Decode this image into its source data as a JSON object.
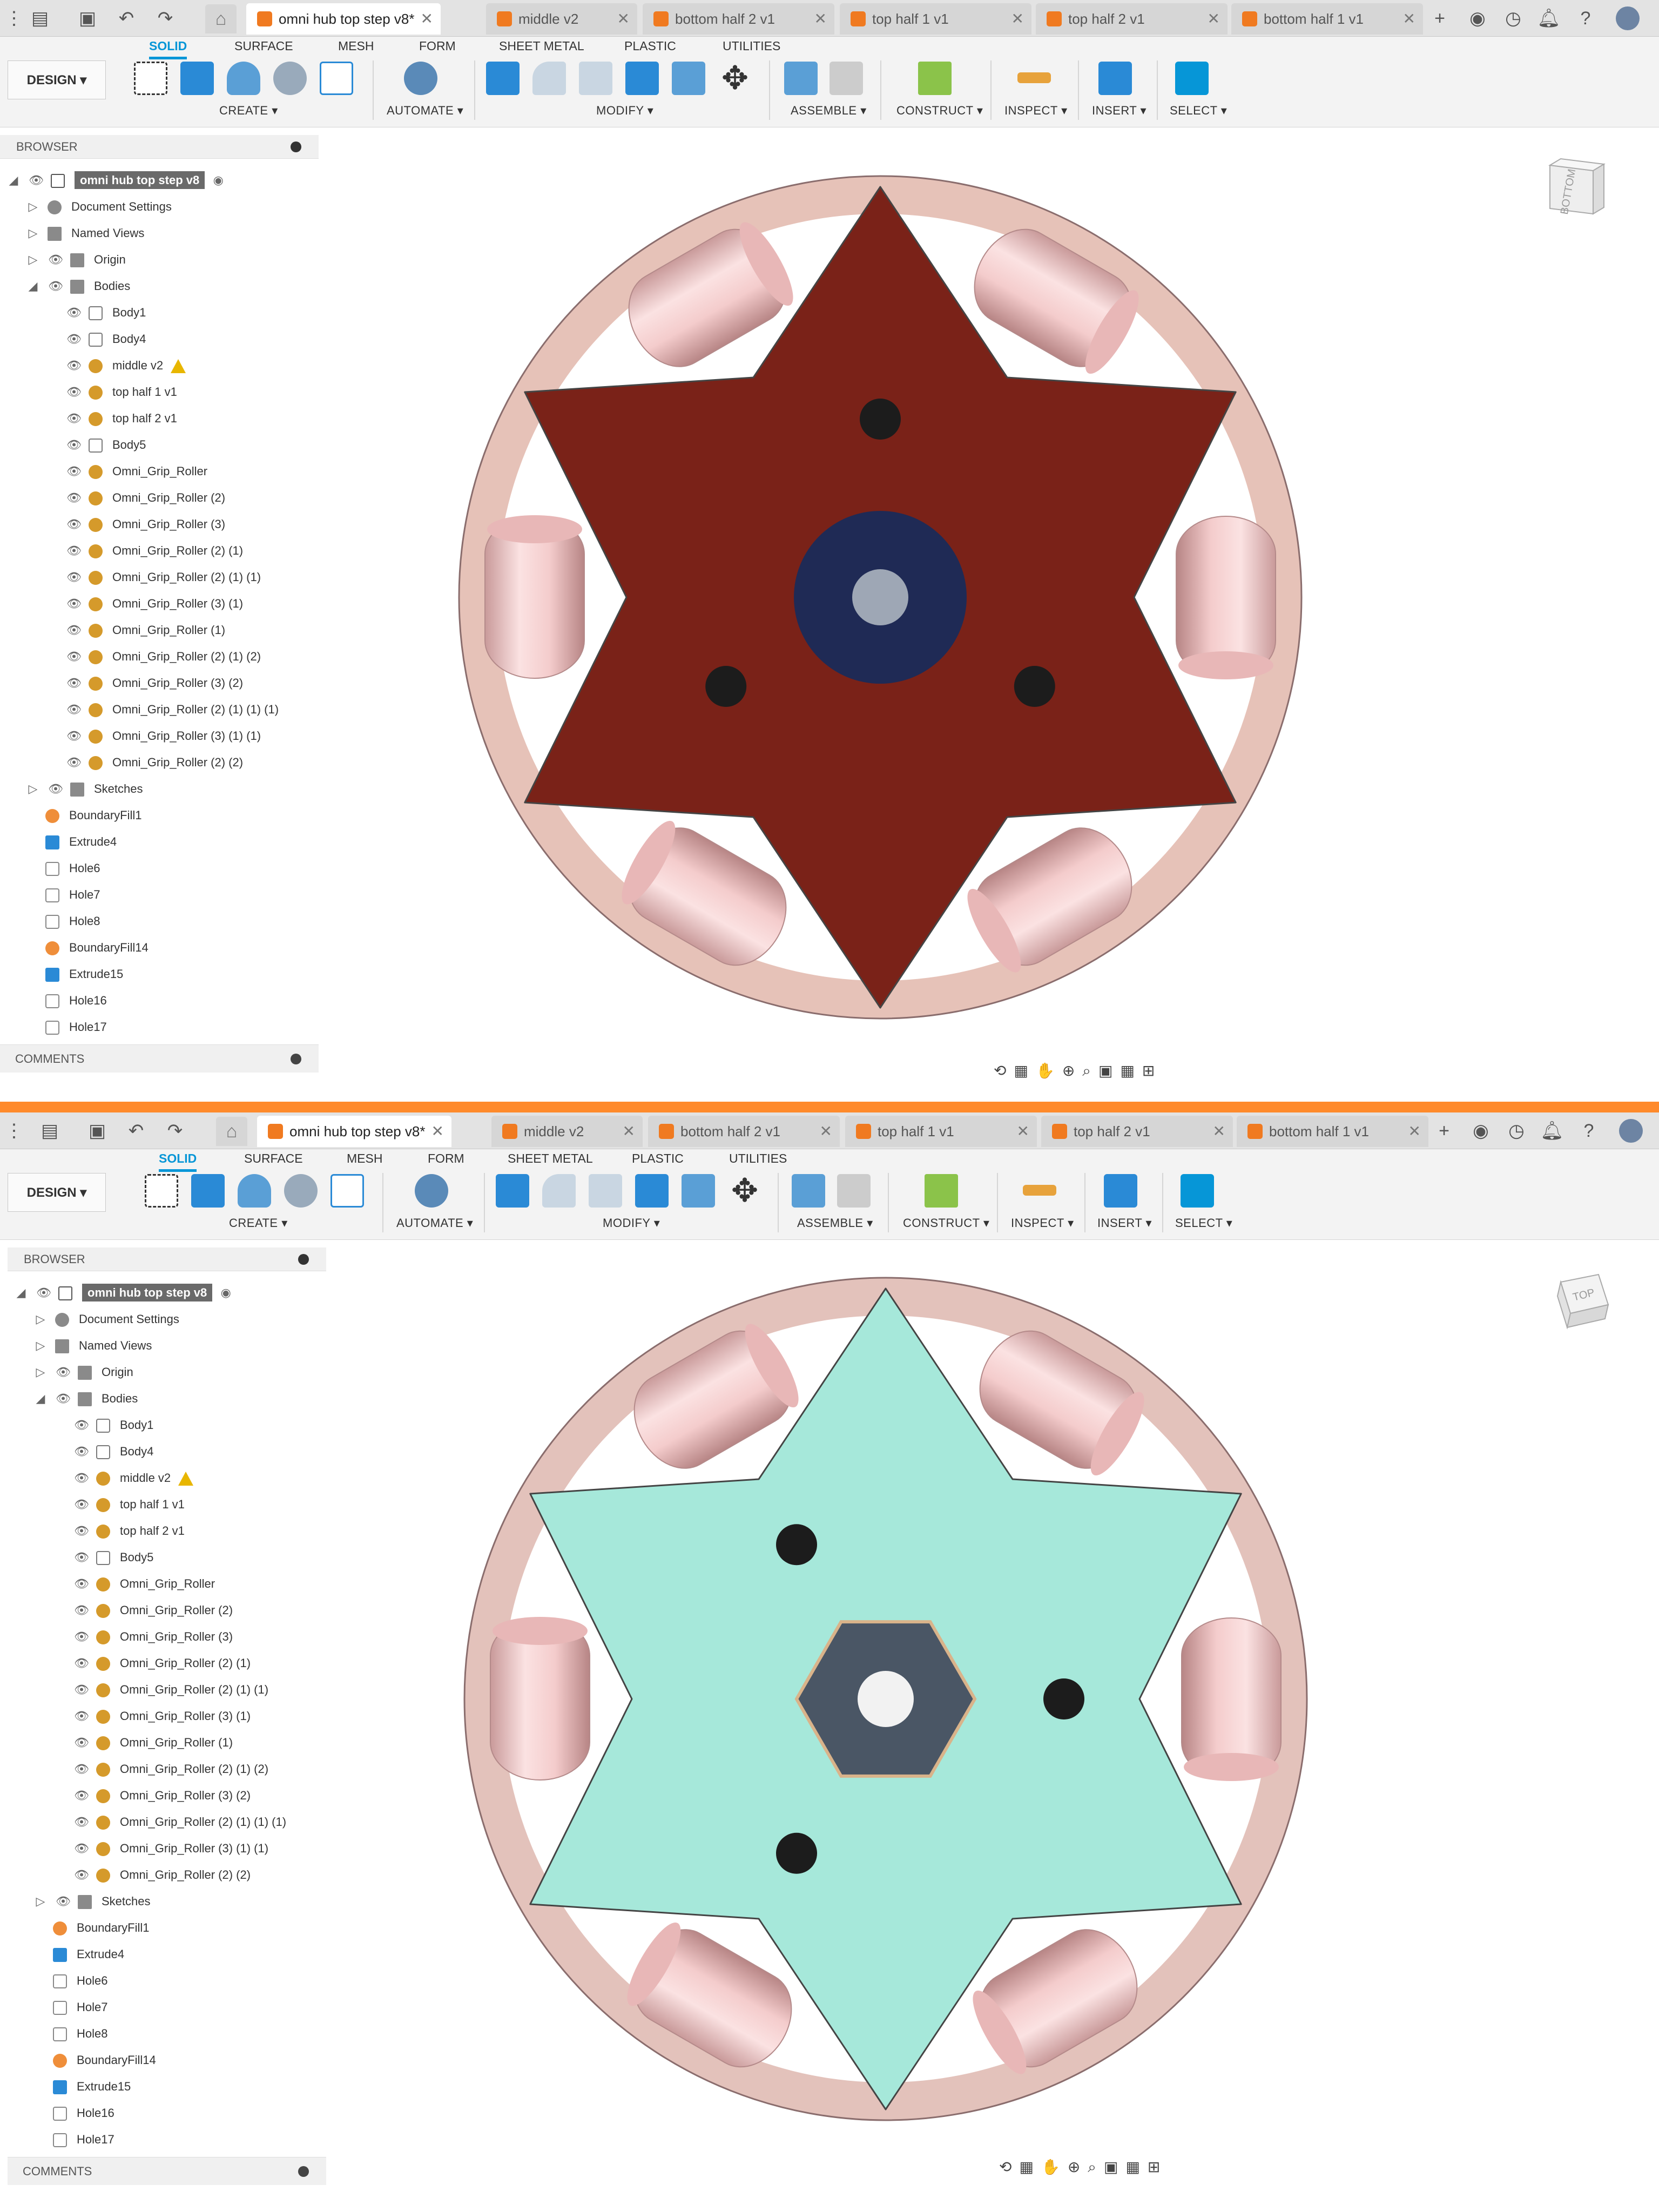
{
  "tabs": [
    {
      "label": "omni hub top step v8*",
      "active": true
    },
    {
      "label": "middle v2",
      "active": false
    },
    {
      "label": "bottom half 2 v1",
      "active": false
    },
    {
      "label": "top half 1 v1",
      "active": false
    },
    {
      "label": "top half 2 v1",
      "active": false
    },
    {
      "label": "bottom half 1 v1",
      "active": false
    }
  ],
  "toolbar": {
    "workspace": "DESIGN ▾",
    "ribbon_tabs": [
      "SOLID",
      "SURFACE",
      "MESH",
      "FORM",
      "SHEET METAL",
      "PLASTIC",
      "UTILITIES"
    ],
    "groups": [
      "CREATE ▾",
      "AUTOMATE ▾",
      "MODIFY ▾",
      "ASSEMBLE ▾",
      "CONSTRUCT ▾",
      "INSPECT ▾",
      "INSERT ▾",
      "SELECT ▾"
    ]
  },
  "browser": {
    "title": "BROWSER",
    "root": "omni hub top step v8",
    "items": [
      "Document Settings",
      "Named Views",
      "Origin",
      "Bodies",
      "Body1",
      "Body4",
      "middle v2",
      "top half 1 v1",
      "top half 2 v1",
      "Body5",
      "Omni_Grip_Roller",
      "Omni_Grip_Roller (2)",
      "Omni_Grip_Roller (3)",
      "Omni_Grip_Roller (2) (1)",
      "Omni_Grip_Roller (2) (1) (1)",
      "Omni_Grip_Roller (3) (1)",
      "Omni_Grip_Roller (1)",
      "Omni_Grip_Roller (2) (1) (2)",
      "Omni_Grip_Roller (3) (2)",
      "Omni_Grip_Roller (2) (1) (1) (1)",
      "Omni_Grip_Roller (3) (1) (1)",
      "Omni_Grip_Roller (2) (2)",
      "Sketches",
      "BoundaryFill1",
      "Extrude4",
      "Hole6",
      "Hole7",
      "Hole8",
      "BoundaryFill14",
      "Extrude15",
      "Hole16",
      "Hole17"
    ]
  },
  "comments_label": "COMMENTS",
  "viewcube": {
    "top_pane": "BOTTOM",
    "bottom_pane": "TOP"
  },
  "colors": {
    "accent": "#0696d7",
    "hub_top_pane": "#7a2218",
    "hub_bottom_pane": "#a6e8da",
    "roller": "#f2c3c3",
    "divider": "#ff8a2b"
  }
}
